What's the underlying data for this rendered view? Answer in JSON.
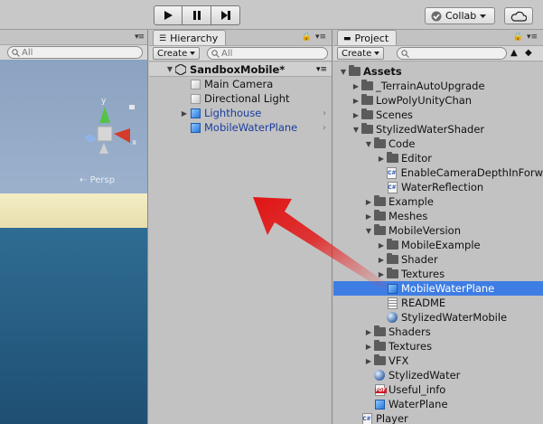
{
  "toolbar": {
    "collab_label": "Collab"
  },
  "scene": {
    "search_placeholder": "All",
    "persp_label": "Persp",
    "gizmo": {
      "y": "y",
      "x": "x"
    }
  },
  "hierarchy": {
    "tab_label": "Hierarchy",
    "create_label": "Create",
    "search_placeholder": "All",
    "root": "SandboxMobile*",
    "items": [
      {
        "label": "Main Camera",
        "icon": "gameobject-icon",
        "blue": false,
        "expand": false
      },
      {
        "label": "Directional Light",
        "icon": "gameobject-icon",
        "blue": false,
        "expand": false
      },
      {
        "label": "Lighthouse",
        "icon": "prefab-icon",
        "blue": true,
        "expand": true
      },
      {
        "label": "MobileWaterPlane",
        "icon": "prefab-icon",
        "blue": true,
        "expand": false
      }
    ]
  },
  "project": {
    "tab_label": "Project",
    "create_label": "Create",
    "items": [
      {
        "label": "Assets",
        "icon": "folder-icon",
        "indent": 0,
        "arrow": "down",
        "bold": true
      },
      {
        "label": "_TerrainAutoUpgrade",
        "icon": "folder-icon",
        "indent": 1,
        "arrow": "right"
      },
      {
        "label": "LowPolyUnityChan",
        "icon": "folder-icon",
        "indent": 1,
        "arrow": "right"
      },
      {
        "label": "Scenes",
        "icon": "folder-icon",
        "indent": 1,
        "arrow": "right"
      },
      {
        "label": "StylizedWaterShader",
        "icon": "folder-icon",
        "indent": 1,
        "arrow": "down"
      },
      {
        "label": "Code",
        "icon": "folder-icon",
        "indent": 2,
        "arrow": "down"
      },
      {
        "label": "Editor",
        "icon": "folder-icon",
        "indent": 3,
        "arrow": "right"
      },
      {
        "label": "EnableCameraDepthInForw",
        "icon": "csharp-icon",
        "indent": 3,
        "arrow": ""
      },
      {
        "label": "WaterReflection",
        "icon": "csharp-icon",
        "indent": 3,
        "arrow": ""
      },
      {
        "label": "Example",
        "icon": "folder-icon",
        "indent": 2,
        "arrow": "right"
      },
      {
        "label": "Meshes",
        "icon": "folder-icon",
        "indent": 2,
        "arrow": "right"
      },
      {
        "label": "MobileVersion",
        "icon": "folder-icon",
        "indent": 2,
        "arrow": "down"
      },
      {
        "label": "MobileExample",
        "icon": "folder-icon",
        "indent": 3,
        "arrow": "right"
      },
      {
        "label": "Shader",
        "icon": "folder-icon",
        "indent": 3,
        "arrow": "right"
      },
      {
        "label": "Textures",
        "icon": "folder-icon",
        "indent": 3,
        "arrow": "right"
      },
      {
        "label": "MobileWaterPlane",
        "icon": "prefab-icon",
        "indent": 3,
        "arrow": "",
        "selected": true
      },
      {
        "label": "README",
        "icon": "text-file-icon",
        "indent": 3,
        "arrow": ""
      },
      {
        "label": "StylizedWaterMobile",
        "icon": "material-sphere-icon",
        "indent": 3,
        "arrow": ""
      },
      {
        "label": "Shaders",
        "icon": "folder-icon",
        "indent": 2,
        "arrow": "right"
      },
      {
        "label": "Textures",
        "icon": "folder-icon",
        "indent": 2,
        "arrow": "right"
      },
      {
        "label": "VFX",
        "icon": "folder-icon",
        "indent": 2,
        "arrow": "right"
      },
      {
        "label": "StylizedWater",
        "icon": "material-sphere-icon",
        "indent": 2,
        "arrow": ""
      },
      {
        "label": "Useful_info",
        "icon": "pdf-icon",
        "indent": 2,
        "arrow": ""
      },
      {
        "label": "WaterPlane",
        "icon": "prefab-icon",
        "indent": 2,
        "arrow": ""
      },
      {
        "label": "Player",
        "icon": "csharp-icon",
        "indent": 1,
        "arrow": ""
      }
    ]
  }
}
